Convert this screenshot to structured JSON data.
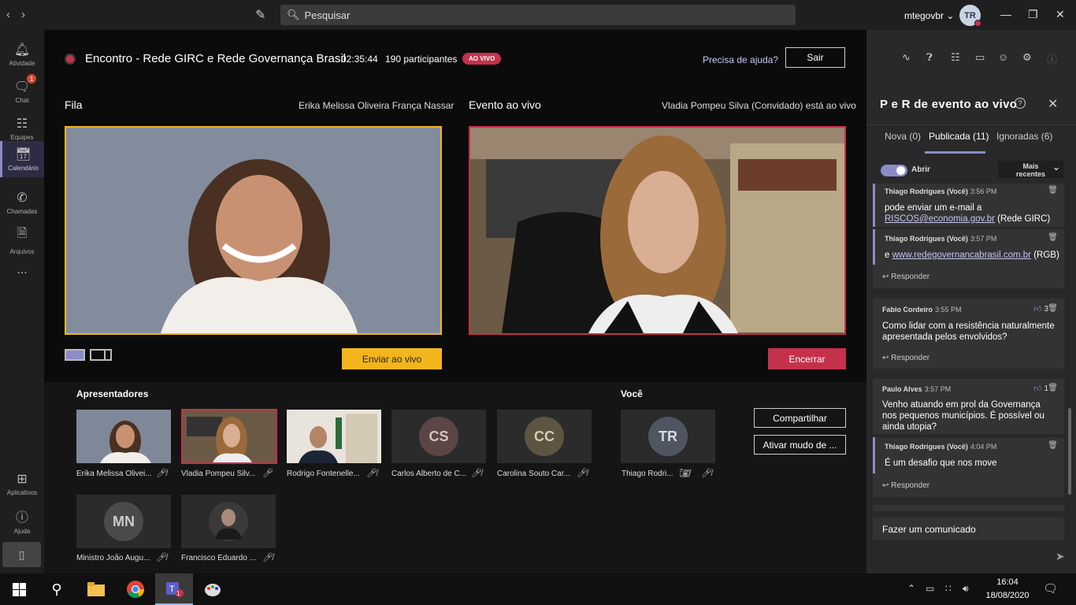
{
  "topbar": {
    "search_placeholder": "Pesquisar",
    "account": "mtegovbr",
    "account_initials": "TR"
  },
  "rail": {
    "items": [
      {
        "label": "Atividade",
        "icon": "bell-icon"
      },
      {
        "label": "Chat",
        "icon": "chat-icon",
        "badge": "1"
      },
      {
        "label": "Equipes",
        "icon": "teams-icon"
      },
      {
        "label": "Calendário",
        "icon": "calendar-icon",
        "active": true
      },
      {
        "label": "Chamadas",
        "icon": "phone-icon"
      },
      {
        "label": "Arquivos",
        "icon": "file-icon"
      },
      {
        "label": "...",
        "icon": "more-icon"
      }
    ],
    "bottom": [
      {
        "label": "Aplicativos",
        "icon": "apps-icon"
      },
      {
        "label": "Ajuda",
        "icon": "help-icon"
      }
    ]
  },
  "event": {
    "title": "Encontro - Rede GIRC e Rede Governança Brasil",
    "timer": "02:35:44",
    "participants": "190 participantes",
    "live_badge": "AO VIVO",
    "help": "Precisa de ajuda?",
    "leave": "Sair"
  },
  "queue": {
    "title": "Fila",
    "presenter": "Erika Melissa Oliveira França Nassar",
    "send_button": "Enviar ao vivo"
  },
  "live": {
    "title": "Evento ao vivo",
    "status": "Vladia Pompeu Silva (Convidado) está ao vivo",
    "end_button": "Encerrar"
  },
  "presenters": {
    "title": "Apresentadores",
    "tiles": [
      {
        "name": "Erika Melissa Olivei...",
        "kind": "video"
      },
      {
        "name": "Vladia Pompeu Silv...",
        "kind": "video"
      },
      {
        "name": "Rodrigo Fontenelle...",
        "kind": "video"
      },
      {
        "name": "Carlos Alberto de C...",
        "initials": "CS",
        "kind": "initials",
        "color": "#5c4545"
      },
      {
        "name": "Carolina Souto Car...",
        "initials": "CC",
        "kind": "initials",
        "color": "#5d5441"
      },
      {
        "name": "Ministro João Augu...",
        "initials": "MN",
        "kind": "initials",
        "color": "#4a4a4a"
      },
      {
        "name": "Francisco Eduardo ...",
        "kind": "photo"
      }
    ]
  },
  "you": {
    "title": "Você",
    "name": "Thiago Rodri...",
    "initials": "TR",
    "share": "Compartilhar",
    "mute_all": "Ativar mudo de ..."
  },
  "qa": {
    "title": "P e R de evento ao vivo",
    "tabs": [
      "Nova (0)",
      "Publicada (11)",
      "Ignoradas (6)"
    ],
    "toggle_label": "Abrir",
    "sort": "Mais recentes",
    "messages": [
      {
        "author": "Thiago Rodrigues (Você)",
        "time": "3:56 PM",
        "text_pre": "pode enviar um e-mail a",
        "link": "RISCOS@economia.gov.br",
        "text_post": " (Rede GIRC)"
      },
      {
        "author": "Thiago Rodrigues (Você)",
        "time": "3:57 PM",
        "text_pre": "e ",
        "link": "www.redegovernancabrasil.com.br",
        "text_post": " (RGB)"
      },
      {
        "author": "Fabio Cordeiro",
        "time": "3:55 PM",
        "likes": "3",
        "text": "Como lidar com a resistência naturalmente apresentada pelos envolvidos?"
      },
      {
        "author": "Paulo Alves",
        "time": "3:57 PM",
        "likes": "1",
        "text": "Venho atuando em prol da Governança nos pequenos municípios. É possível ou ainda utopia?"
      },
      {
        "author": "Thiago Rodrigues (Você)",
        "time": "4:04 PM",
        "text": "É um desafio que nos move"
      }
    ],
    "reply": "Responder",
    "announce": "Fazer um comunicado"
  },
  "taskbar": {
    "time": "16:04",
    "date": "18/08/2020",
    "teams_badge": "1"
  }
}
